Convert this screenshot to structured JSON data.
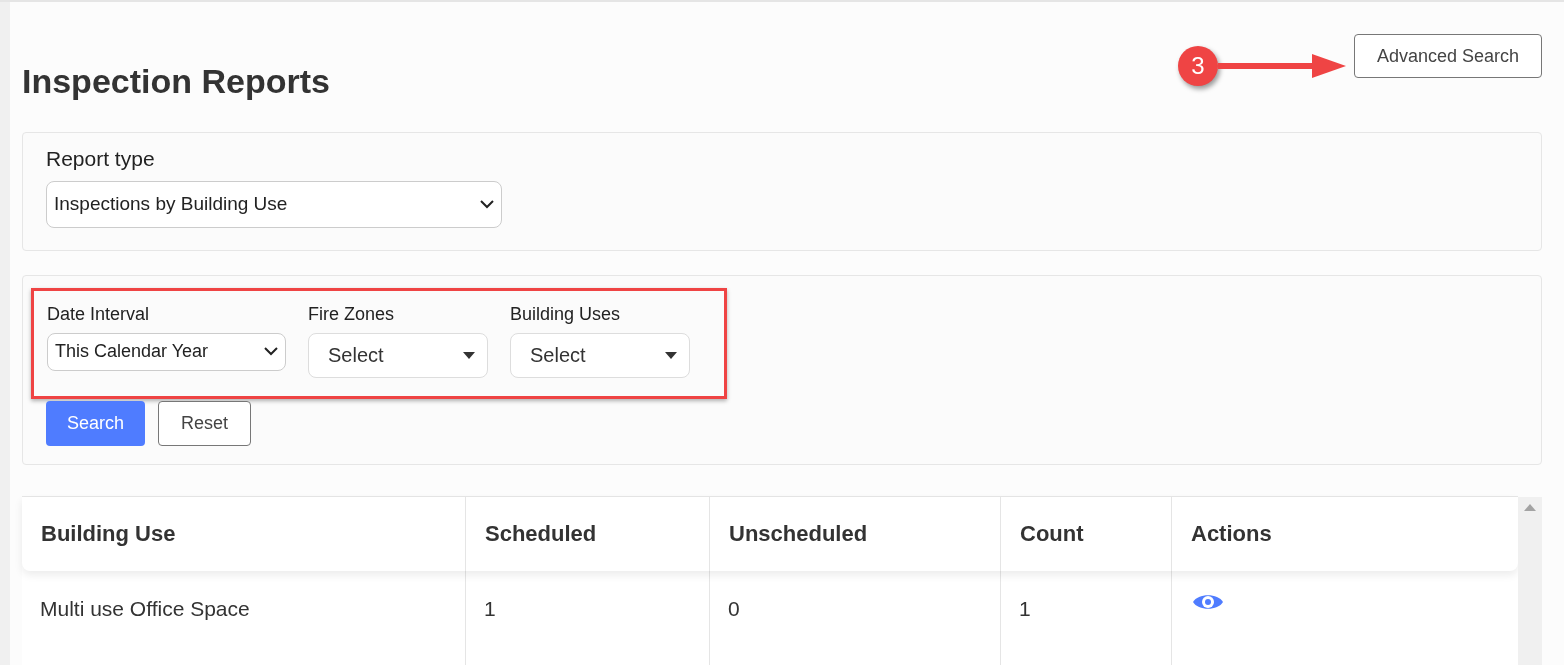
{
  "page": {
    "title": "Inspection Reports"
  },
  "advanced_search": {
    "label": "Advanced Search"
  },
  "callout": {
    "label": "3"
  },
  "report_type": {
    "label": "Report type",
    "value": "Inspections by Building Use"
  },
  "filters": [
    {
      "label": "Date Interval",
      "value": "This Calendar Year",
      "kind": "native"
    },
    {
      "label": "Fire Zones",
      "value": "Select",
      "kind": "custom"
    },
    {
      "label": "Building Uses",
      "value": "Select",
      "kind": "custom"
    }
  ],
  "buttons": [
    {
      "label": "Search",
      "kind": "primary"
    },
    {
      "label": "Reset",
      "kind": "secondary"
    }
  ],
  "table": {
    "columns": [
      "Building Use",
      "Scheduled",
      "Unscheduled",
      "Count",
      "Actions"
    ],
    "rows": [
      {
        "cells": [
          "Multi use Office Space",
          "1",
          "0",
          "1"
        ],
        "actions": [
          {
            "kind": "view"
          }
        ]
      }
    ]
  }
}
